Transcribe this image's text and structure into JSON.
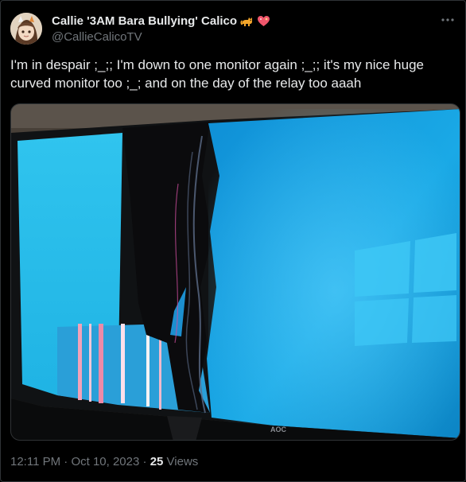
{
  "author": {
    "display_name": "Callie '3AM Bara Bullying' Calico",
    "handle": "@CallieCalicoTV",
    "emoji_icons": [
      "cat-emoji-icon",
      "sparkling-heart-emoji-icon"
    ]
  },
  "tweet": {
    "text_line_1": "I'm in despair ;_;; I'm down to one monitor again ;_;; it's my nice huge",
    "text_line_2": "curved monitor too ;_; and on the day of the relay too aaah"
  },
  "meta": {
    "time": "12:11 PM",
    "sep1": " · ",
    "date": "Oct 10, 2023",
    "sep2": " · ",
    "views_count": "25",
    "views_label": " Views"
  },
  "media": {
    "monitor_brand": "AOC"
  },
  "icons": {
    "more": "more-options-icon"
  },
  "colors": {
    "background": "#000000",
    "text_primary": "#e7e9ea",
    "text_secondary": "#71767b",
    "border": "#2f3336",
    "screen_blue": "#14a6e0"
  }
}
